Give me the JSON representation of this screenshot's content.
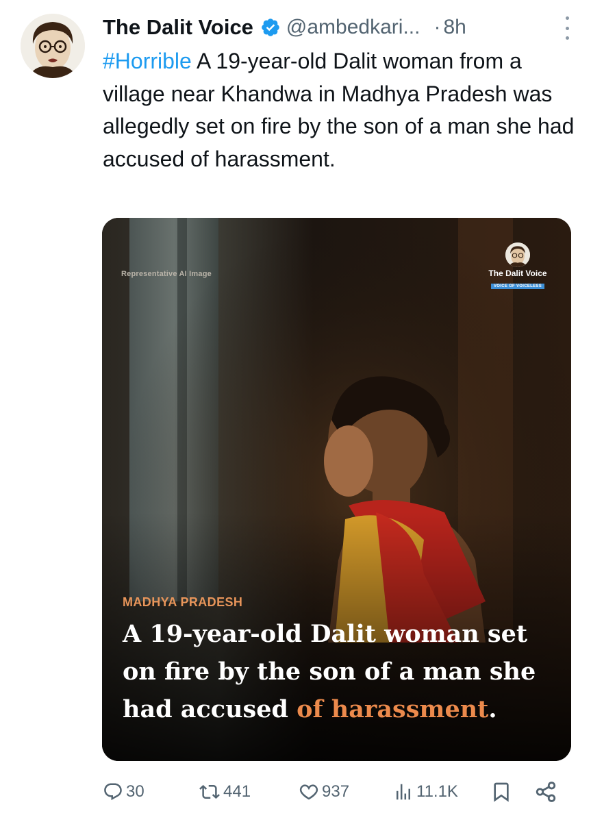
{
  "tweet": {
    "author_name": "The Dalit Voice",
    "handle": "@ambedkari...",
    "separator": "·",
    "time": "8h",
    "hashtag": "#Horrible",
    "body": " A 19-year-old Dalit woman from a village near Khandwa in Madhya Pradesh was allegedly set on fire by the son of a man she had accused of harassment."
  },
  "media": {
    "image_label": "Representative AI Image",
    "brand_name": "The Dalit Voice",
    "brand_tagline": "VOICE OF VOICELESS",
    "region": "MADHYA PRADESH",
    "headline_main": "A 19-year-old Dalit woman set on fire by the son of a man she had accused ",
    "headline_accent": "of harassment",
    "headline_end": "."
  },
  "actions": {
    "replies": "30",
    "reposts": "441",
    "likes": "937",
    "views": "11.1K"
  },
  "colors": {
    "link": "#1d9bf0",
    "secondary_text": "#536471",
    "verified": "#1d9bf0",
    "headline_accent": "#ec8a4c",
    "region_label": "#e8955a"
  },
  "icons": [
    "verified-badge-icon",
    "more-options-icon",
    "reply-icon",
    "repost-icon",
    "like-icon",
    "views-icon",
    "bookmark-icon",
    "share-icon"
  ]
}
